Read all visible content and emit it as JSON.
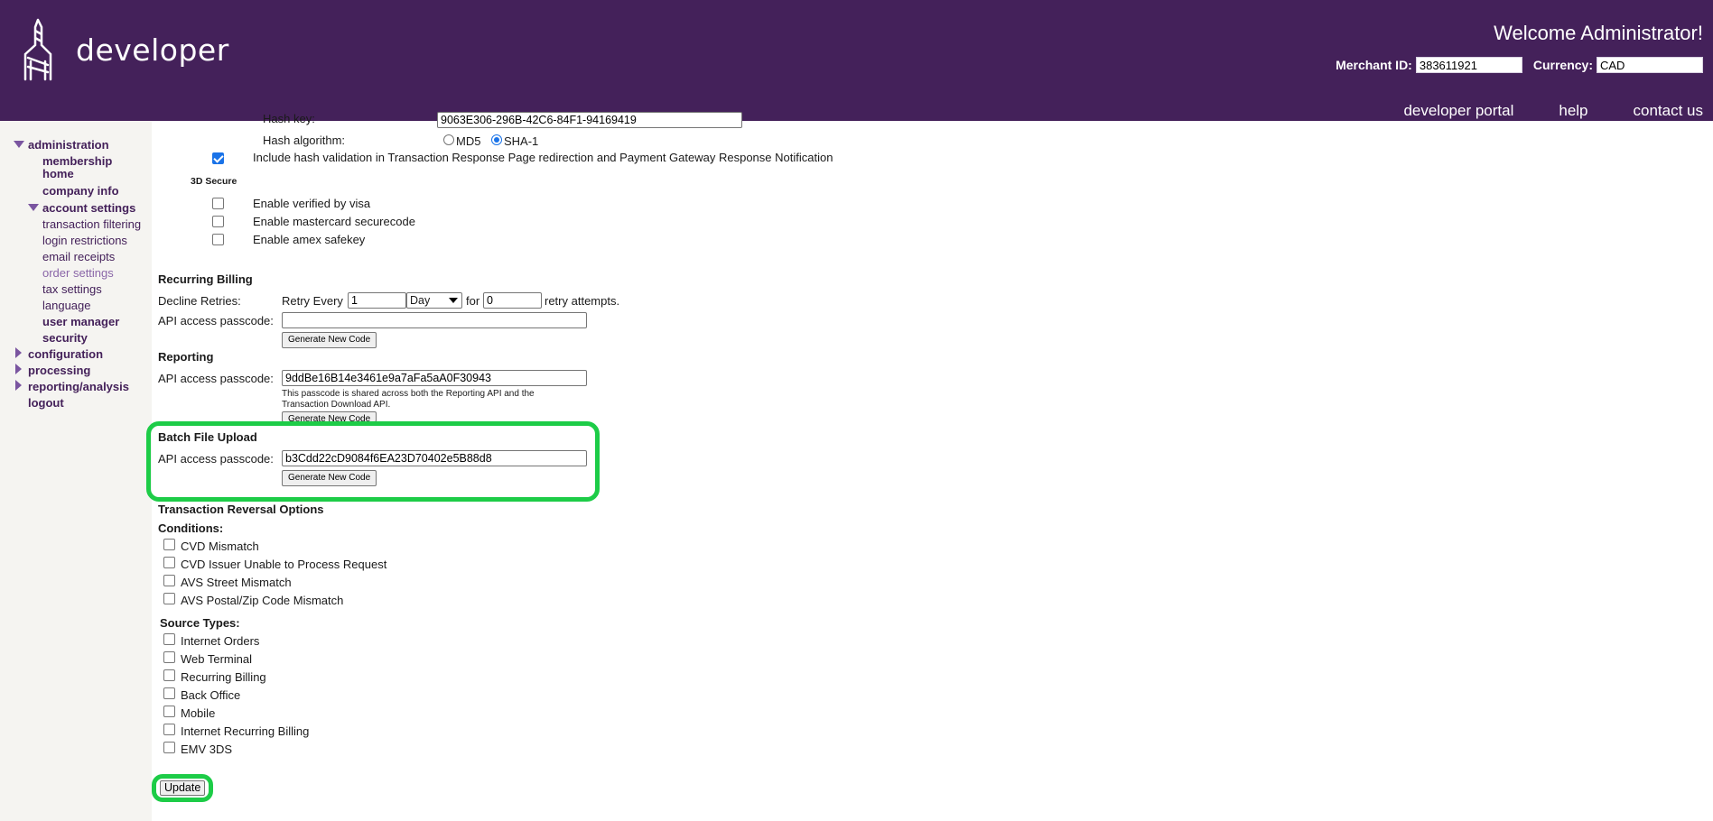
{
  "header": {
    "logo_text": "developer",
    "welcome": "Welcome Administrator!",
    "merchant_label": "Merchant ID:",
    "merchant_value": "383611921",
    "currency_label": "Currency:",
    "currency_value": "CAD",
    "nav": [
      "developer portal",
      "help",
      "contact us"
    ]
  },
  "sidebar": {
    "administration": "administration",
    "membership_home_1": "membership",
    "membership_home_2": "home",
    "company_info": "company info",
    "account_settings": "account settings",
    "transaction_filtering": "transaction filtering",
    "login_restrictions": "login restrictions",
    "email_receipts": "email receipts",
    "order_settings": "order settings",
    "tax_settings": "tax settings",
    "language": "language",
    "user_manager": "user manager",
    "security": "security",
    "configuration": "configuration",
    "processing": "processing",
    "reporting_analysis": "reporting/analysis",
    "logout": "logout"
  },
  "hash": {
    "key_label": "Hash key:",
    "key_value": "9063E306-296B-42C6-84F1-94169419",
    "algorithm_label": "Hash algorithm:",
    "md5": "MD5",
    "sha1": "SHA-1",
    "selected": "SHA-1",
    "include_label": "Include hash validation in Transaction Response Page redirection and Payment Gateway Response Notification",
    "include_checked": true
  },
  "secure3d": {
    "title": "3D Secure",
    "options": [
      {
        "label": "Enable verified by visa",
        "checked": false
      },
      {
        "label": "Enable mastercard securecode",
        "checked": false
      },
      {
        "label": "Enable amex safekey",
        "checked": false
      }
    ]
  },
  "recurring": {
    "title": "Recurring Billing",
    "decline_label": "Decline Retries:",
    "retry_every": "Retry Every",
    "retry_value": "1",
    "period": "Day",
    "for_label": "for",
    "attempts_value": "0",
    "attempts_suffix": "retry attempts.",
    "api_label": "API access passcode:",
    "api_value": "",
    "gen_button": "Generate New Code"
  },
  "reporting": {
    "title": "Reporting",
    "api_label": "API access passcode:",
    "api_value": "9ddBe16B14e3461e9a7aFa5aA0F30943",
    "note_1": "This passcode is shared across both the Reporting API and the",
    "note_2": "Transaction Download API.",
    "gen_button": "Generate New Code"
  },
  "batch": {
    "title": "Batch File Upload",
    "api_label": "API access passcode:",
    "api_value": "b3Cdd22cD9084f6EA23D70402e5B88d8",
    "gen_button": "Generate New Code"
  },
  "reversal": {
    "title": "Transaction Reversal Options",
    "conditions_label": "Conditions:",
    "conditions": [
      {
        "label": "CVD Mismatch",
        "checked": false
      },
      {
        "label": "CVD Issuer Unable to Process Request",
        "checked": false
      },
      {
        "label": "AVS Street Mismatch",
        "checked": false
      },
      {
        "label": "AVS Postal/Zip Code Mismatch",
        "checked": false
      }
    ],
    "source_label": "Source Types:",
    "sources": [
      {
        "label": "Internet Orders",
        "checked": false
      },
      {
        "label": "Web Terminal",
        "checked": false
      },
      {
        "label": "Recurring Billing",
        "checked": false
      },
      {
        "label": "Back Office",
        "checked": false
      },
      {
        "label": "Mobile",
        "checked": false
      },
      {
        "label": "Internet Recurring Billing",
        "checked": false
      },
      {
        "label": "EMV 3DS",
        "checked": false
      }
    ]
  },
  "update_button": "Update",
  "colors": {
    "header_bg": "#44215a",
    "nav_text": "#44215a",
    "highlight": "#1dcc47",
    "sidebar_bg": "#f5f4f1"
  }
}
